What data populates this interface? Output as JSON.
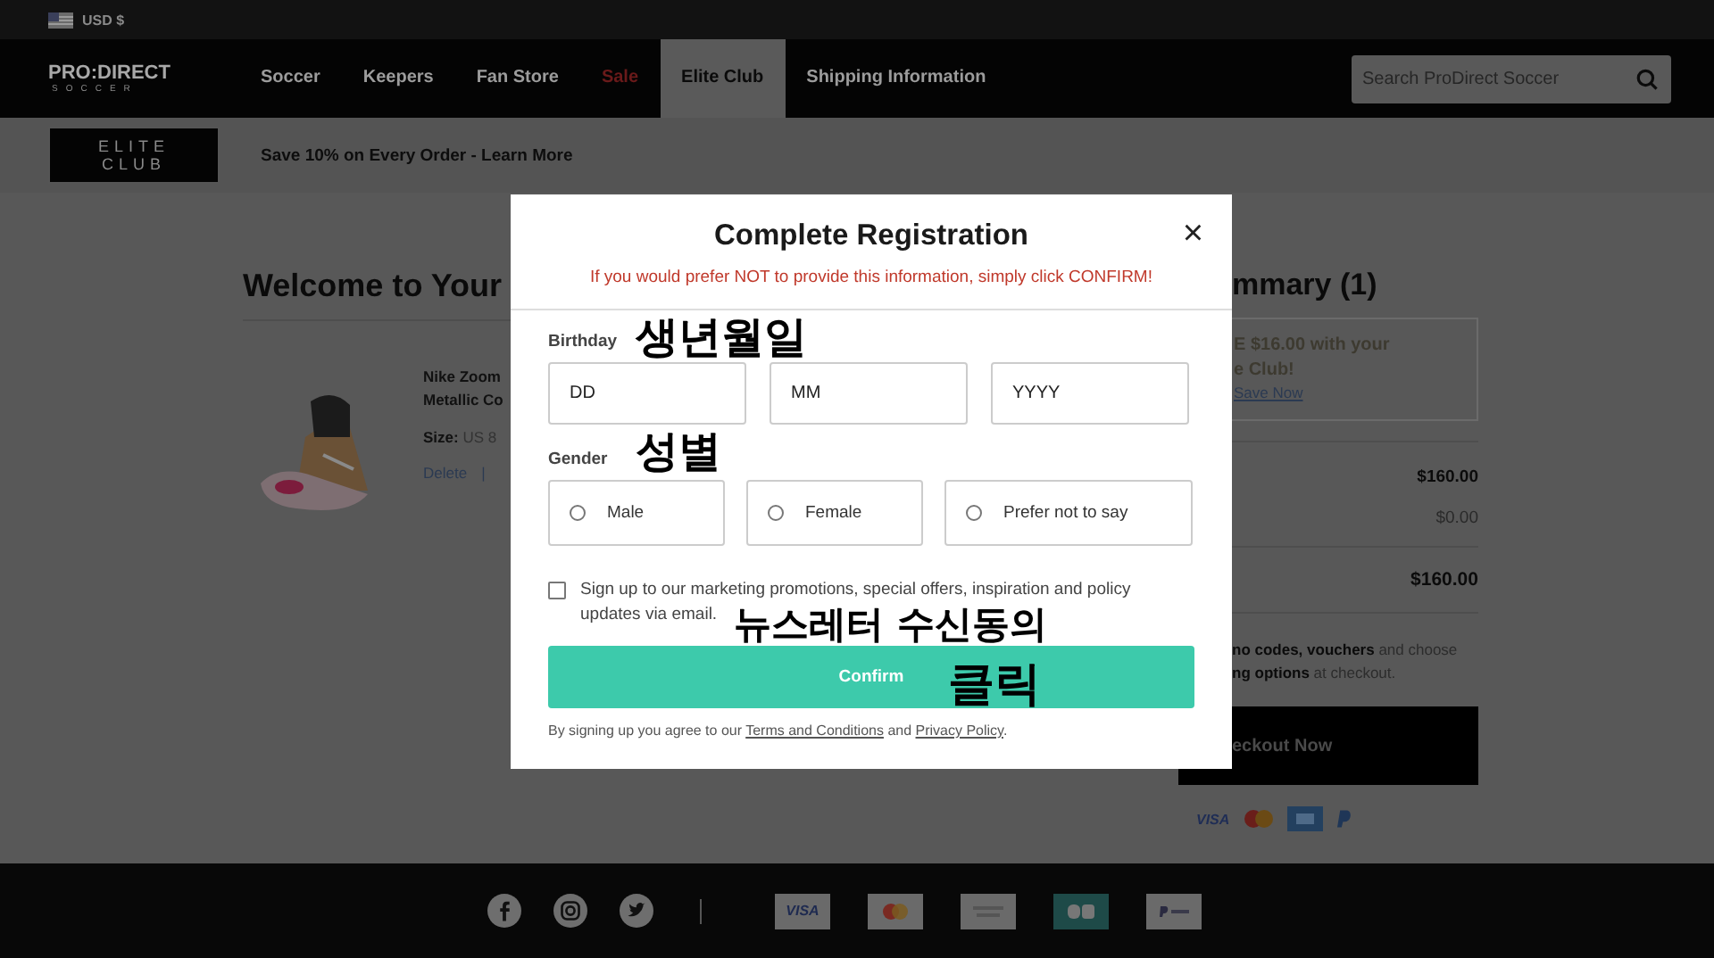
{
  "top_bar": {
    "currency": "USD $"
  },
  "nav": {
    "logo_top": "PRO:DIRECT",
    "logo_bottom": "SOCCER",
    "items": [
      {
        "label": "Soccer",
        "kind": "normal",
        "selected": false
      },
      {
        "label": "Keepers",
        "kind": "normal",
        "selected": false
      },
      {
        "label": "Fan Store",
        "kind": "normal",
        "selected": false
      },
      {
        "label": "Sale",
        "kind": "sale",
        "selected": false
      },
      {
        "label": "Elite Club",
        "kind": "normal",
        "selected": true
      },
      {
        "label": "Shipping Information",
        "kind": "normal",
        "selected": false
      }
    ],
    "search": {
      "placeholder": "Search ProDirect Soccer"
    }
  },
  "promo_bar": {
    "badge": "ELITE CLUB",
    "text": "Save 10% on Every Order - Learn More"
  },
  "basket": {
    "heading": "Welcome to Your",
    "item": {
      "name_lines": [
        "Nike Zoom",
        "Metallic Co"
      ],
      "size_label": "Size:",
      "size": "US 8",
      "actions": [
        "Delete",
        "|"
      ]
    }
  },
  "summary": {
    "heading": "mmary (1)",
    "promo_lines": [
      "E $16.00 with your",
      "e Club!"
    ],
    "promo_link": "Save Now",
    "rows": [
      {
        "value": "$160.00",
        "bold": true
      },
      {
        "value": "$0.00",
        "bold": false
      }
    ],
    "total": "$160.00",
    "note_lines": [
      "**no codes, vouchers** and choose",
      "**ng options** at checkout."
    ],
    "checkout": "eckout Now",
    "payments": [
      {
        "kind": "visa",
        "label": "VISA"
      },
      {
        "kind": "mastercard"
      },
      {
        "kind": "amex"
      },
      {
        "kind": "paypal"
      }
    ]
  },
  "modal": {
    "title": "Complete Registration",
    "close": "×",
    "notice": "If you would prefer NOT to provide this information, simply click CONFIRM!",
    "birthday_label": "Birthday",
    "date_fields": [
      {
        "placeholder": "DD"
      },
      {
        "placeholder": "MM"
      },
      {
        "placeholder": "YYYY"
      }
    ],
    "gender_label": "Gender",
    "gender_options": [
      {
        "label": "Male",
        "selected": false
      },
      {
        "label": "Female",
        "selected": false
      },
      {
        "label": "Prefer not to say",
        "selected": false
      }
    ],
    "newsletter": {
      "text_lines": [
        "Sign up to our marketing promotions, special offers, inspiration and policy",
        "updates via email."
      ],
      "checked": false
    },
    "confirm": "Confirm",
    "legal": [
      {
        "kind": "text",
        "text": "By signing up you agree to our"
      },
      {
        "kind": "link",
        "text": "Terms and Conditions"
      },
      {
        "kind": "text",
        "text": "and"
      },
      {
        "kind": "link",
        "text": "Privacy Policy"
      },
      {
        "kind": "text",
        "text": "."
      }
    ]
  },
  "annotations": [
    {
      "text": "생년월일"
    },
    {
      "text": "성별"
    },
    {
      "text": "뉴스레터 수신동의"
    },
    {
      "text": "클릭"
    }
  ],
  "footer": {
    "social": [
      {
        "kind": "facebook"
      },
      {
        "kind": "instagram"
      },
      {
        "kind": "twitter"
      }
    ],
    "cards": [
      {
        "kind": "visa",
        "label": "VISA"
      },
      {
        "kind": "mastercard"
      },
      {
        "kind": "amex"
      },
      {
        "kind": "cb"
      },
      {
        "kind": "paypal"
      }
    ]
  }
}
